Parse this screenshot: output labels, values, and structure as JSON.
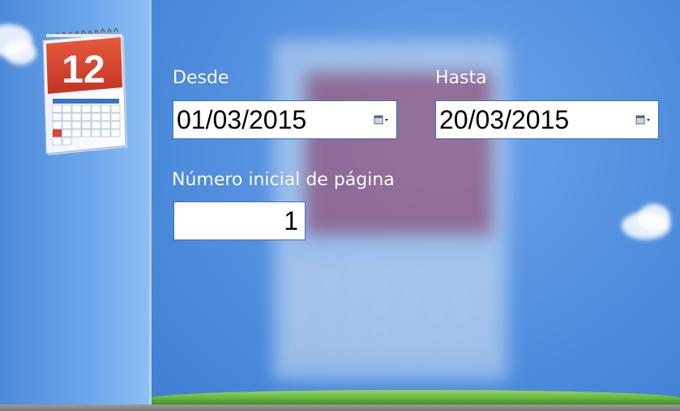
{
  "icon": {
    "day_number": "12"
  },
  "form": {
    "from_label": "Desde",
    "from_value": "01/03/2015",
    "to_label": "Hasta",
    "to_value": "20/03/2015",
    "page_label": "Número inicial de página",
    "page_value": "1"
  },
  "colors": {
    "sky": "#5d97e0",
    "calendar_red": "#d9452f",
    "field_border": "#3b6fb6",
    "grass": "#63b33b"
  }
}
